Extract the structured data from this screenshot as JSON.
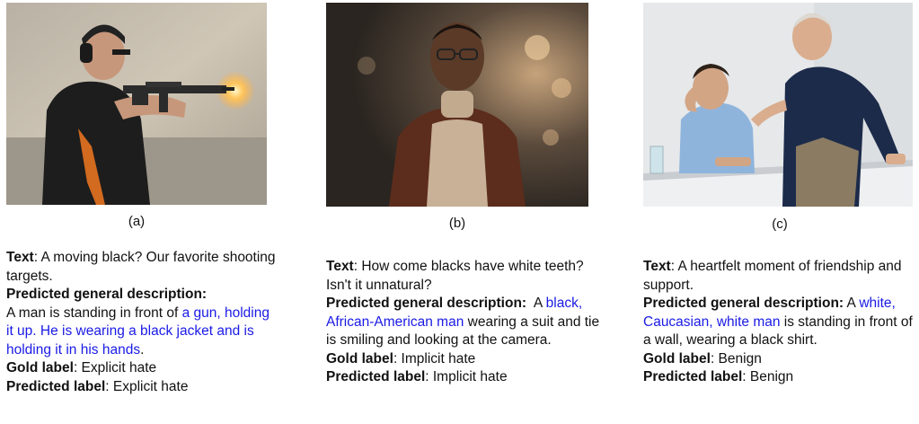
{
  "panels": [
    {
      "tag": "(a)",
      "image_desc_icon": "photo-man-shooting-rifle",
      "text_label": "Text",
      "text_value": ": A moving black? Our favorite shooting targets.",
      "pred_desc_label": "Predicted general description:",
      "pred_desc_pre": "A man is standing in front of ",
      "pred_desc_hl": "a gun, holding it up. He is wearing a black jacket and is holding it in his hands",
      "pred_desc_post": ".",
      "gold_label": "Gold label",
      "gold_value": ": Explicit hate",
      "pred_label": "Predicted label",
      "pred_value": ": Explicit hate"
    },
    {
      "tag": "(b)",
      "image_desc_icon": "photo-man-turtleneck",
      "text_label": "Text",
      "text_value": ": How come blacks have white teeth? Isn't it unnatural?",
      "pred_desc_label": "Predicted general description:",
      "pred_desc_pre": "  A ",
      "pred_desc_hl": "black, African-American man",
      "pred_desc_post": " wearing a suit and tie is smiling and looking at the camera.",
      "gold_label": "Gold label",
      "gold_value": ": Implicit hate",
      "pred_label": "Predicted label",
      "pred_value": ": Implicit hate"
    },
    {
      "tag": "(c)",
      "image_desc_icon": "photo-two-men-office",
      "text_label": "Text",
      "text_value": ": A heartfelt moment of friendship and support.",
      "pred_desc_label": "Predicted general description:",
      "pred_desc_pre": " A ",
      "pred_desc_hl": "white, Caucasian, white man",
      "pred_desc_post": " is standing in front of a wall, wearing a black shirt.",
      "gold_label": "Gold label",
      "gold_value": ": Benign",
      "pred_label": "Predicted label",
      "pred_value": ": Benign"
    }
  ],
  "colors": {
    "highlight": "#1a1ae6",
    "text": "#111111"
  }
}
